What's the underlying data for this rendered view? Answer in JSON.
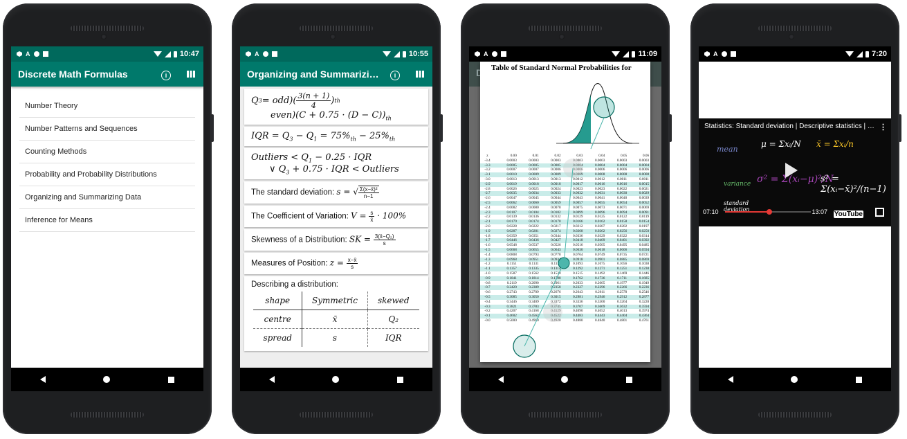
{
  "nav_icons": {
    "back": "back-triangle-icon",
    "home": "home-circle-icon",
    "recents": "recents-square-icon"
  },
  "status_icons": [
    "shield-icon",
    "a-icon",
    "circle-icon",
    "sd-card-icon",
    "wifi-icon",
    "signal-icon",
    "battery-icon"
  ],
  "colors": {
    "appbar": "#00796b",
    "statusbar": "#00695c",
    "highlight_row": "#c9ece9",
    "progress": "#e53935"
  },
  "phone1": {
    "time": "10:47",
    "title": "Discrete Math Formulas",
    "menu": [
      "Number Theory",
      "Number Patterns and Sequences",
      "Counting Methods",
      "Probability and Probability Distributions",
      "Organizing and Summarizing Data",
      "Inference for Means"
    ]
  },
  "phone2": {
    "time": "10:55",
    "title": "Organizing and Summarizing...",
    "q3_line1_left": "Q",
    "q3_line1_mid": "= odd)(",
    "q3_frac_num": "3(n + 1)",
    "q3_frac_den": "4",
    "q3_line1_right": ")",
    "q3_line2": "even)(C + 0.75 · (D − C))",
    "iqr": "IQR = Q",
    "iqr_mid": " − Q",
    "iqr_right": " = 75%",
    "iqr_end": " − 25%",
    "outliers_line1": "Outliers < Q",
    "outliers_line1b": " − 0.25 · IQR",
    "outliers_line2": "∨ Q",
    "outliers_line2b": " + 0.75 · IQR < Outliers",
    "std_label": "The standard deviation: ",
    "std_math": "s = √",
    "std_frac_num": "Σ(x−x̄)²",
    "std_frac_den": "n−1",
    "cv_label": "The Coefficient of Variation: ",
    "cv_math": "V = ",
    "cv_frac_num": "s",
    "cv_frac_den": "x̄",
    "cv_tail": " · 100%",
    "skew_label": "Skewness of a Distribution: ",
    "skew_math": "SK = ",
    "skew_frac_num": "3(x̄−Q₂)",
    "skew_frac_den": "s",
    "pos_label": "Measures of Position: ",
    "pos_math": "z = ",
    "pos_frac_num": "x−x̄",
    "pos_frac_den": "s",
    "describe_label": "Describing a distribution:",
    "table": [
      [
        "shape",
        "Symmetric",
        "skewed"
      ],
      [
        "centre",
        "x̄",
        "Q₂"
      ],
      [
        "spread",
        "s",
        "IQR"
      ]
    ]
  },
  "phone3": {
    "time": "11:09",
    "behind_title": "D",
    "image_title": "Table of Standard Normal Probabilities for",
    "header": [
      "z",
      "0.00",
      "0.01",
      "0.02",
      "0.03",
      "0.04",
      "0.05",
      "0.06"
    ],
    "rows": [
      [
        "-3.4",
        "0.0003",
        "0.0003",
        "0.0003",
        "0.0003",
        "0.0003",
        "0.0003",
        "0.0003"
      ],
      [
        "-3.3",
        "0.0005",
        "0.0005",
        "0.0005",
        "0.0004",
        "0.0004",
        "0.0004",
        "0.0004"
      ],
      [
        "-3.2",
        "0.0007",
        "0.0007",
        "0.0006",
        "0.0006",
        "0.0006",
        "0.0006",
        "0.0006"
      ],
      [
        "-3.1",
        "0.0010",
        "0.0009",
        "0.0009",
        "0.0009",
        "0.0008",
        "0.0008",
        "0.0008"
      ],
      [
        "-3.0",
        "0.0013",
        "0.0013",
        "0.0013",
        "0.0012",
        "0.0012",
        "0.0011",
        "0.0011"
      ],
      [
        "-2.9",
        "0.0019",
        "0.0018",
        "0.0018",
        "0.0017",
        "0.0016",
        "0.0016",
        "0.0015"
      ],
      [
        "-2.8",
        "0.0026",
        "0.0025",
        "0.0024",
        "0.0023",
        "0.0023",
        "0.0022",
        "0.0021"
      ],
      [
        "-2.7",
        "0.0035",
        "0.0034",
        "0.0033",
        "0.0032",
        "0.0031",
        "0.0030",
        "0.0029"
      ],
      [
        "-2.6",
        "0.0047",
        "0.0045",
        "0.0044",
        "0.0043",
        "0.0041",
        "0.0040",
        "0.0039"
      ],
      [
        "-2.5",
        "0.0062",
        "0.0060",
        "0.0059",
        "0.0057",
        "0.0055",
        "0.0054",
        "0.0052"
      ],
      [
        "-2.4",
        "0.0082",
        "0.0080",
        "0.0078",
        "0.0075",
        "0.0073",
        "0.0071",
        "0.0069"
      ],
      [
        "-2.3",
        "0.0107",
        "0.0104",
        "0.0102",
        "0.0099",
        "0.0096",
        "0.0094",
        "0.0091"
      ],
      [
        "-2.2",
        "0.0139",
        "0.0136",
        "0.0132",
        "0.0129",
        "0.0125",
        "0.0122",
        "0.0119"
      ],
      [
        "-2.1",
        "0.0179",
        "0.0174",
        "0.0170",
        "0.0166",
        "0.0162",
        "0.0158",
        "0.0154"
      ],
      [
        "-2.0",
        "0.0228",
        "0.0222",
        "0.0217",
        "0.0212",
        "0.0207",
        "0.0202",
        "0.0197"
      ],
      [
        "-1.9",
        "0.0287",
        "0.0281",
        "0.0274",
        "0.0268",
        "0.0262",
        "0.0256",
        "0.0250"
      ],
      [
        "-1.8",
        "0.0359",
        "0.0351",
        "0.0344",
        "0.0336",
        "0.0329",
        "0.0322",
        "0.0314"
      ],
      [
        "-1.7",
        "0.0446",
        "0.0436",
        "0.0427",
        "0.0418",
        "0.0409",
        "0.0401",
        "0.0392"
      ],
      [
        "-1.6",
        "0.0548",
        "0.0537",
        "0.0526",
        "0.0516",
        "0.0505",
        "0.0495",
        "0.0485"
      ],
      [
        "-1.5",
        "0.0668",
        "0.0655",
        "0.0643",
        "0.0630",
        "0.0618",
        "0.0606",
        "0.0594"
      ],
      [
        "-1.4",
        "0.0808",
        "0.0793",
        "0.0778",
        "0.0764",
        "0.0749",
        "0.0735",
        "0.0721"
      ],
      [
        "-1.3",
        "0.0968",
        "0.0951",
        "0.0934",
        "0.0918",
        "0.0901",
        "0.0885",
        "0.0869"
      ],
      [
        "-1.2",
        "0.1151",
        "0.1131",
        "0.1112",
        "0.1093",
        "0.1075",
        "0.1056",
        "0.1038"
      ],
      [
        "-1.1",
        "0.1357",
        "0.1335",
        "0.1314",
        "0.1292",
        "0.1271",
        "0.1251",
        "0.1230"
      ],
      [
        "-1.0",
        "0.1587",
        "0.1562",
        "0.1539",
        "0.1515",
        "0.1492",
        "0.1469",
        "0.1446"
      ],
      [
        "-0.9",
        "0.1841",
        "0.1814",
        "0.1788",
        "0.1762",
        "0.1736",
        "0.1711",
        "0.1685"
      ],
      [
        "-0.8",
        "0.2119",
        "0.2090",
        "0.2061",
        "0.2033",
        "0.2005",
        "0.1977",
        "0.1949"
      ],
      [
        "-0.7",
        "0.2420",
        "0.2389",
        "0.2358",
        "0.2327",
        "0.2296",
        "0.2266",
        "0.2236"
      ],
      [
        "-0.6",
        "0.2743",
        "0.2709",
        "0.2676",
        "0.2643",
        "0.2611",
        "0.2578",
        "0.2546"
      ],
      [
        "-0.5",
        "0.3085",
        "0.3050",
        "0.3015",
        "0.2981",
        "0.2946",
        "0.2912",
        "0.2877"
      ],
      [
        "-0.4",
        "0.3446",
        "0.3409",
        "0.3372",
        "0.3336",
        "0.3300",
        "0.3264",
        "0.3228"
      ],
      [
        "-0.3",
        "0.3821",
        "0.3783",
        "0.3745",
        "0.3707",
        "0.3669",
        "0.3632",
        "0.3594"
      ],
      [
        "-0.2",
        "0.4207",
        "0.4168",
        "0.4129",
        "0.4090",
        "0.4052",
        "0.4013",
        "0.3974"
      ],
      [
        "-0.1",
        "0.4602",
        "0.4562",
        "0.4522",
        "0.4483",
        "0.4443",
        "0.4404",
        "0.4364"
      ],
      [
        "-0.0",
        "0.5000",
        "0.4960",
        "0.4920",
        "0.4880",
        "0.4840",
        "0.4801",
        "0.4761"
      ]
    ]
  },
  "phone4": {
    "time": "7:20",
    "video_title": "Statistics: Standard deviation | Descriptive statistics | Pr...",
    "current_time": "07:10",
    "duration": "13:07",
    "youtube_logo": "YouTube",
    "progress": 0.52,
    "board": {
      "mean": "mean",
      "variance": "variance",
      "std": "standard deviation",
      "mu": "μ = Σxᵢ/N",
      "xbar": "x̄ = Σxᵢ/n"
    }
  }
}
